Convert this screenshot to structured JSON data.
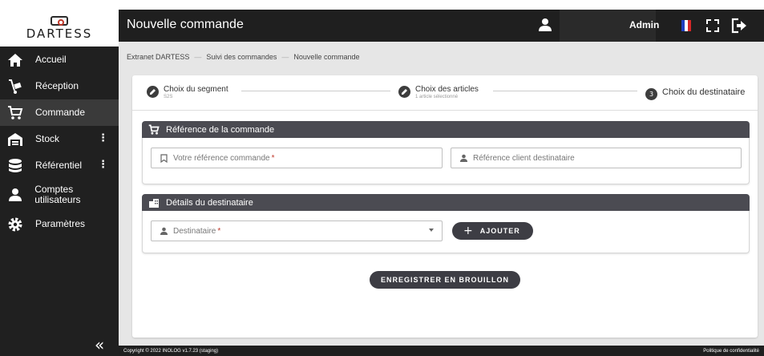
{
  "brand": {
    "name": "DARTESS"
  },
  "sidebar": {
    "items": [
      {
        "label": "Accueil",
        "icon": "home-icon"
      },
      {
        "label": "Réception",
        "icon": "dolly-icon"
      },
      {
        "label": "Commande",
        "icon": "cart-icon",
        "active": true
      },
      {
        "label": "Stock",
        "icon": "warehouse-icon",
        "has_menu": true
      },
      {
        "label": "Référentiel",
        "icon": "database-icon",
        "has_menu": true
      },
      {
        "label": "Comptes utilisateurs",
        "icon": "user-icon"
      },
      {
        "label": "Paramètres",
        "icon": "gear-icon"
      }
    ],
    "collapse_glyph": "«"
  },
  "header": {
    "title": "Nouvelle commande",
    "user": "Admin",
    "language_flag": "fr"
  },
  "breadcrumb": [
    "Extranet DARTESS",
    "Suivi des commandes",
    "Nouvelle commande"
  ],
  "breadcrumb_sep": "—",
  "stepper": {
    "steps": [
      {
        "label": "Choix du segment",
        "sub": "S2S",
        "state": "done"
      },
      {
        "label": "Choix des articles",
        "sub": "1 article sélectionné",
        "state": "done"
      },
      {
        "label": "Choix du destinataire",
        "number": "3",
        "state": "active"
      }
    ]
  },
  "reference_section": {
    "title": "Référence de la commande",
    "order_ref_placeholder": "Votre référence commande",
    "client_ref_placeholder": "Référence client destinataire"
  },
  "recipient_section": {
    "title": "Détails du destinataire",
    "recipient_placeholder": "Destinataire",
    "add_label": "AJOUTER"
  },
  "save_draft_label": "ENREGISTRER EN BROUILLON",
  "required_mark": "*",
  "footer": {
    "copyright": "Copyright © 2022 INOLOG  v1.7.23 (staging)",
    "privacy": "Politique de confidentialité"
  },
  "colors": {
    "sidebar_bg": "#202020",
    "header_bg": "#1f1f1f",
    "section_header": "#4b4b52",
    "button": "#3d3d44",
    "required": "#c0392b"
  }
}
